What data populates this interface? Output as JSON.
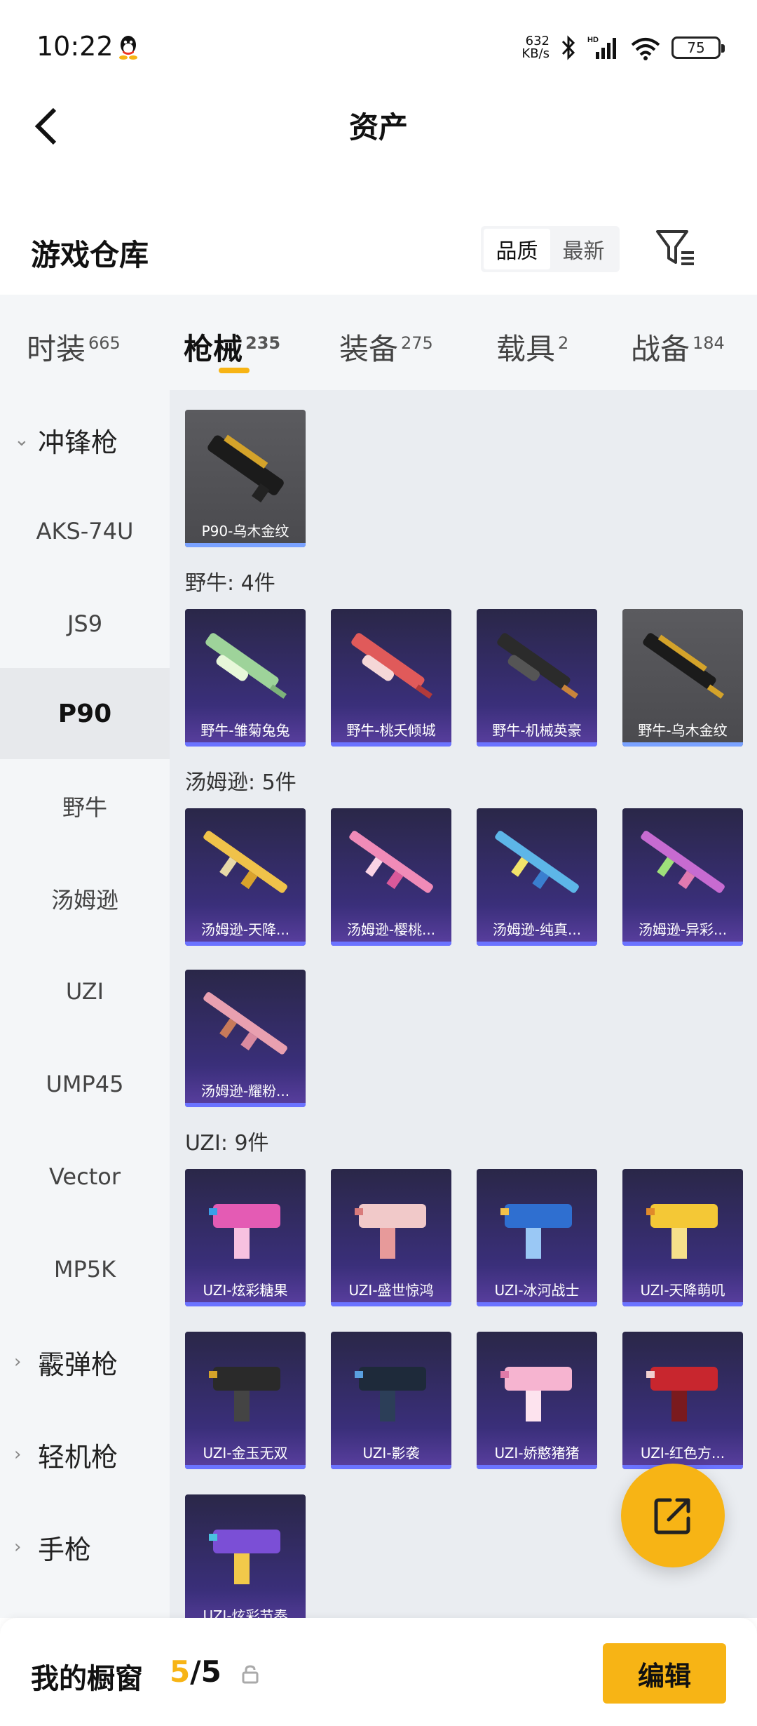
{
  "status": {
    "time": "10:22",
    "netspeed_value": "632",
    "netspeed_unit": "KB/s",
    "battery": "75"
  },
  "header": {
    "title": "资产"
  },
  "section": {
    "title": "游戏仓库",
    "sort_options": [
      "品质",
      "最新"
    ],
    "active_sort": "品质"
  },
  "tabs": [
    {
      "label": "时装",
      "count": "665"
    },
    {
      "label": "枪械",
      "count": "235"
    },
    {
      "label": "装备",
      "count": "275"
    },
    {
      "label": "载具",
      "count": "2"
    },
    {
      "label": "战备",
      "count": "184"
    }
  ],
  "active_tab": "枪械",
  "sidebar": {
    "items": [
      {
        "label": "冲锋枪",
        "type": "group",
        "expanded": true
      },
      {
        "label": "AKS-74U"
      },
      {
        "label": "JS9"
      },
      {
        "label": "P90",
        "selected": true
      },
      {
        "label": "野牛"
      },
      {
        "label": "汤姆逊"
      },
      {
        "label": "UZI"
      },
      {
        "label": "UMP45"
      },
      {
        "label": "Vector"
      },
      {
        "label": "MP5K"
      },
      {
        "label": "霰弹枪",
        "type": "group"
      },
      {
        "label": "轻机枪",
        "type": "group"
      },
      {
        "label": "手枪",
        "type": "group"
      }
    ]
  },
  "groups": [
    {
      "label": "",
      "items": [
        {
          "name": "P90-乌木金纹",
          "rarity": "gray"
        }
      ]
    },
    {
      "label": "野牛: 4件",
      "items": [
        {
          "name": "野牛-雏菊兔兔",
          "rarity": "purple"
        },
        {
          "name": "野牛-桃夭倾城",
          "rarity": "purple"
        },
        {
          "name": "野牛-机械英豪",
          "rarity": "purple"
        },
        {
          "name": "野牛-乌木金纹",
          "rarity": "gray"
        }
      ]
    },
    {
      "label": "汤姆逊: 5件",
      "items": [
        {
          "name": "汤姆逊-天降...",
          "rarity": "purple"
        },
        {
          "name": "汤姆逊-樱桃...",
          "rarity": "purple"
        },
        {
          "name": "汤姆逊-纯真...",
          "rarity": "purple"
        },
        {
          "name": "汤姆逊-异彩...",
          "rarity": "purple"
        },
        {
          "name": "汤姆逊-耀粉...",
          "rarity": "purple"
        }
      ]
    },
    {
      "label": "UZI: 9件",
      "items": [
        {
          "name": "UZI-炫彩糖果",
          "rarity": "purple"
        },
        {
          "name": "UZI-盛世惊鸿",
          "rarity": "purple"
        },
        {
          "name": "UZI-冰河战士",
          "rarity": "purple"
        },
        {
          "name": "UZI-天降萌叽",
          "rarity": "purple"
        },
        {
          "name": "UZI-金玉无双",
          "rarity": "purple"
        },
        {
          "name": "UZI-影袭",
          "rarity": "purple"
        },
        {
          "name": "UZI-娇憨猪猪",
          "rarity": "purple"
        },
        {
          "name": "UZI-红色方...",
          "rarity": "purple"
        },
        {
          "name": "UZI-炫彩节奏",
          "rarity": "purple"
        }
      ]
    }
  ],
  "bottom": {
    "window_label": "我的橱窗",
    "window_current": "5",
    "window_total": "/5",
    "edit_label": "编辑"
  },
  "colors": {
    "accent": "#f7b415",
    "card_purple": "#3a2f7a",
    "card_gray": "#4a4a4e"
  }
}
